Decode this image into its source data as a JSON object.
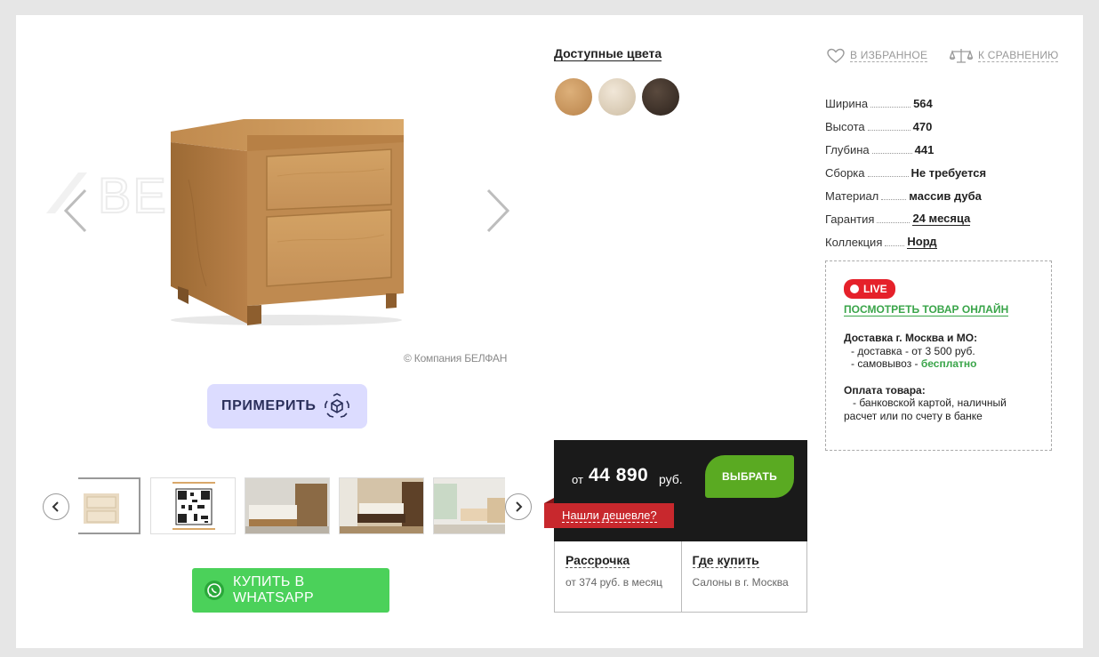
{
  "gallery": {
    "watermark_text": "BELFAN",
    "copyright": "© Компания БЕЛФАН",
    "try_on_label": "ПРИМЕРИТЬ",
    "thumbnails": [
      "product-front",
      "qr-code",
      "bedroom-1",
      "bedroom-2",
      "bedroom-3"
    ]
  },
  "whatsapp": {
    "label": "КУПИТЬ В WHATSAPP"
  },
  "colors": {
    "title": "Доступные цвета",
    "swatches": [
      "#c8955a",
      "#e2d4bf",
      "#3d3028"
    ]
  },
  "actions": {
    "favorite": "В ИЗБРАННОЕ",
    "compare": "К СРАВНЕНИЮ"
  },
  "specs": [
    {
      "key": "Ширина",
      "value": "564"
    },
    {
      "key": "Высота",
      "value": "470"
    },
    {
      "key": "Глубина",
      "value": "441"
    },
    {
      "key": "Сборка",
      "value": "Не требуется"
    },
    {
      "key": "Материал",
      "value": "массив дуба"
    },
    {
      "key": "Гарантия",
      "value": "24 месяца"
    },
    {
      "key": "Коллекция",
      "value": "Норд"
    }
  ],
  "live": {
    "badge": "LIVE",
    "link": "ПОСМОТРЕТЬ ТОВАР ОНЛАЙН",
    "delivery_title": "Доставка г. Москва и МО:",
    "delivery_line1": "- доставка - от 3 500 руб.",
    "delivery_line2_prefix": "- самовывоз - ",
    "delivery_line2_free": "бесплатно",
    "payment_title": "Оплата товара:",
    "payment_text": "- банковской картой, наличный расчет или по счету в банке"
  },
  "price": {
    "from": "от",
    "value": "44 890",
    "currency": "руб.",
    "choose_label": "ВЫБРАТЬ",
    "cheaper_label": "Нашли дешевле?",
    "installment_title": "Рассрочка",
    "installment_sub": "от 374 руб. в месяц",
    "where_title": "Где купить",
    "where_sub": "Салоны в г. Москва"
  },
  "colors_accent": {
    "whatsapp": "#4bd15a",
    "choose": "#5aaa22",
    "cheaper": "#c8282d",
    "live": "#e5212a",
    "link_green": "#3aa54a"
  }
}
